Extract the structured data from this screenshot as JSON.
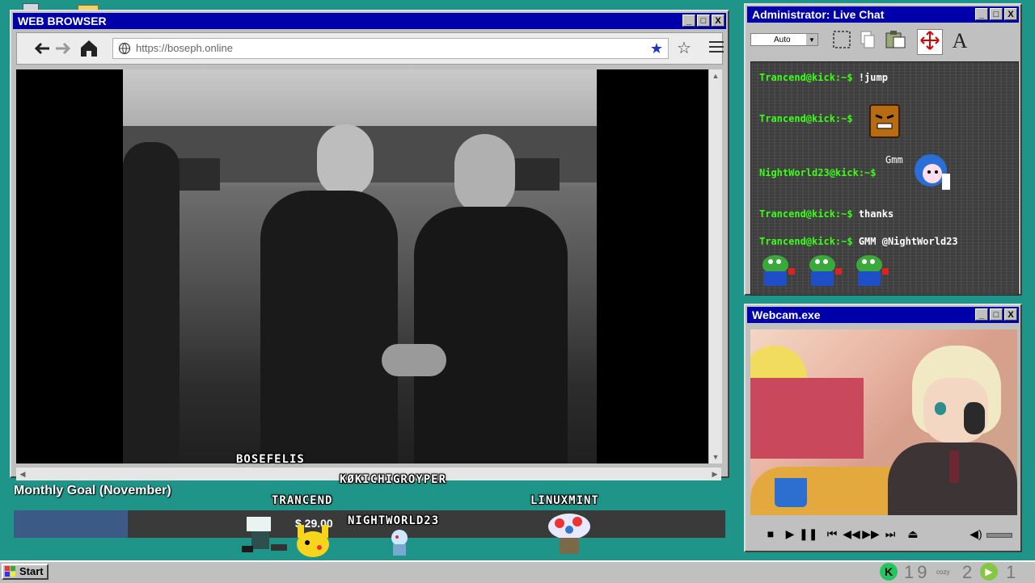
{
  "browser": {
    "title": "WEB BROWSER",
    "url": "https://boseph.online",
    "min_label": "_",
    "max_label": "□",
    "close_label": "X"
  },
  "overlay_names": {
    "bosefelis": "BOSEFELIS",
    "kokichi": "KØKICHIGROYPER",
    "trancend": "TRANCEND",
    "nightworld": "NIGHTWORLD23",
    "linuxmint": "LINUXMINT"
  },
  "goal": {
    "label": "Monthly Goal (November)",
    "amount": "$ 29.00",
    "progress": 0.16,
    "fill_color": "#3c5a86",
    "track_color": "#3a3a3a"
  },
  "chat": {
    "title": "Administrator: Live Chat",
    "font_select": "Auto",
    "font_tool_label": "A",
    "messages": [
      {
        "user": "Trancend@kick:~$",
        "text": "!jump"
      },
      {
        "user": "Trancend@kick:~$",
        "text": ""
      },
      {
        "user": "",
        "text": "Gmm"
      },
      {
        "user": "NightWorld23@kick:~$",
        "text": ""
      },
      {
        "user": "Trancend@kick:~$",
        "text": "thanks"
      },
      {
        "user": "Trancend@kick:~$",
        "text": "GMM @NightWorld23"
      }
    ],
    "user_color": "#39ff14"
  },
  "webcam": {
    "title": "Webcam.exe"
  },
  "taskbar": {
    "start_label": "Start",
    "stat1": "19",
    "stat2": "2",
    "stat3": "1",
    "cozy_label": "cozy"
  },
  "colors": {
    "desktop": "#1f9488",
    "titlebar": "#0000aa",
    "window": "#c0c0c0"
  }
}
